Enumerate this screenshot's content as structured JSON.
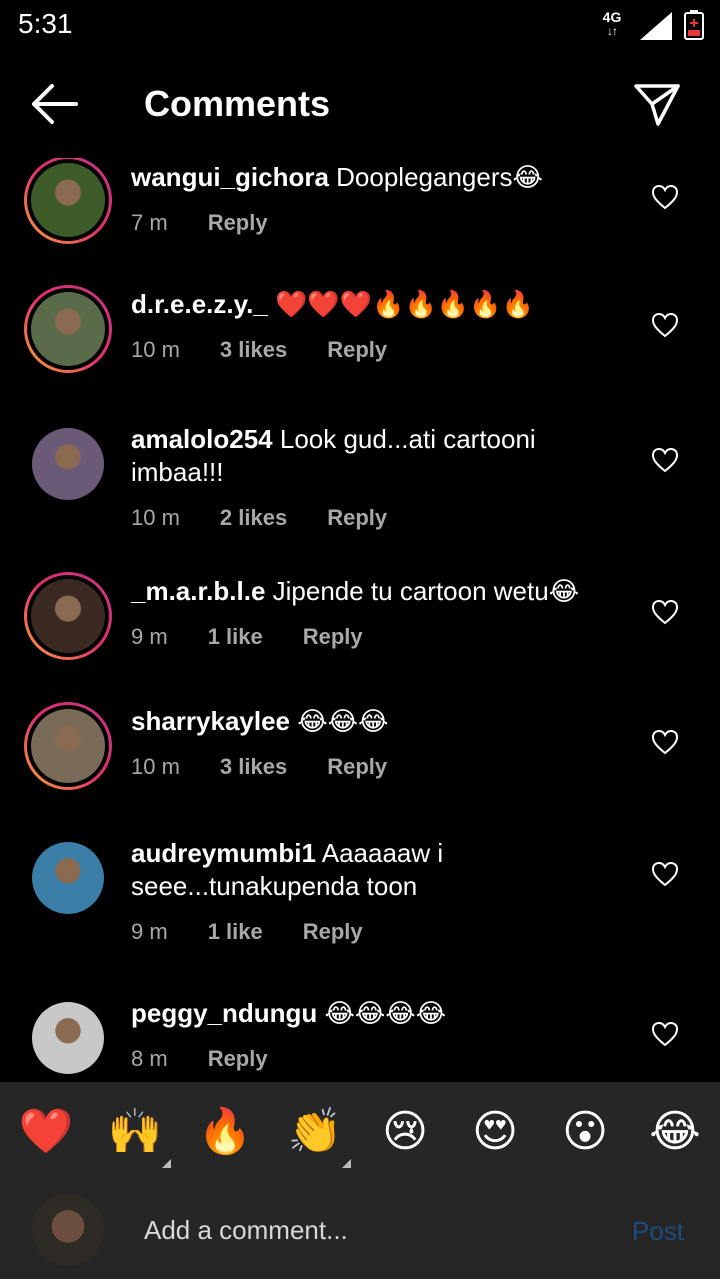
{
  "status_bar": {
    "time": "5:31",
    "network": "4G",
    "network_arrows": "↓↑"
  },
  "header": {
    "title": "Comments",
    "back_icon": "arrow-left-icon",
    "share_icon": "paper-plane-icon"
  },
  "comments": [
    {
      "username": "wangui_gichora",
      "text": " Dooplegangers😂",
      "time": "7 m",
      "likes": "",
      "reply": "Reply",
      "story_ring": true,
      "avatar_color": "#3e5b2a"
    },
    {
      "username": "d.r.e.e.z.y._",
      "text": " ❤️❤️❤️🔥🔥🔥🔥🔥",
      "time": "10 m",
      "likes": "3 likes",
      "reply": "Reply",
      "story_ring": true,
      "avatar_color": "#5a6b4a"
    },
    {
      "username": "amalolo254",
      "text": " Look gud...ati cartooni imbaa!!!",
      "time": "10 m",
      "likes": "2 likes",
      "reply": "Reply",
      "story_ring": false,
      "avatar_color": "#6a5a78"
    },
    {
      "username": "_m.a.r.b.l.e",
      "text": " Jipende tu cartoon wetu😂",
      "time": "9 m",
      "likes": "1 like",
      "reply": "Reply",
      "story_ring": true,
      "avatar_color": "#3a2a22"
    },
    {
      "username": "sharrykaylee",
      "text": " 😂😂😂",
      "time": "10 m",
      "likes": "3 likes",
      "reply": "Reply",
      "story_ring": true,
      "avatar_color": "#7a6a58"
    },
    {
      "username": "audreymumbi1",
      "text": " Aaaaaaw i seee...tunakupenda toon",
      "time": "9 m",
      "likes": "1 like",
      "reply": "Reply",
      "story_ring": false,
      "avatar_color": "#3b7fa8"
    },
    {
      "username": "peggy_ndungu",
      "text": " 😂😂😂😂",
      "time": "8 m",
      "likes": "",
      "reply": "Reply",
      "story_ring": false,
      "avatar_color": "#c8c8c8"
    }
  ],
  "reactions": [
    "❤️",
    "🙌",
    "🔥",
    "👏",
    "😢",
    "😍",
    "😮",
    "😂"
  ],
  "composer": {
    "placeholder": "Add a comment...",
    "post_label": "Post"
  }
}
